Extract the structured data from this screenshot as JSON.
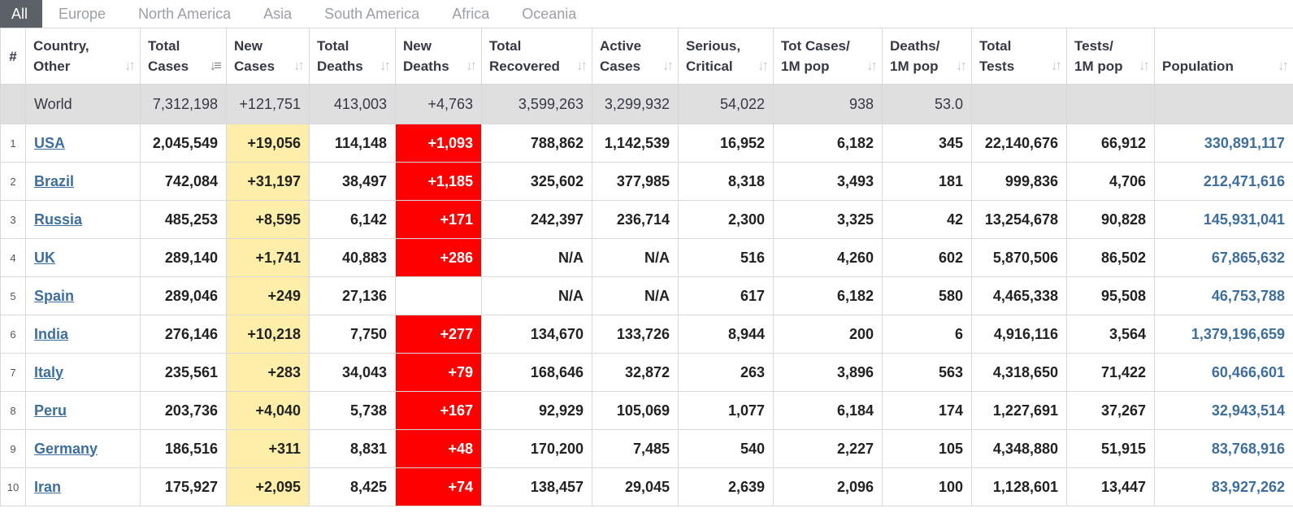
{
  "tabs": [
    "All",
    "Europe",
    "North America",
    "Asia",
    "South America",
    "Africa",
    "Oceania"
  ],
  "headers": {
    "rank": "#",
    "country": [
      "Country,",
      "Other"
    ],
    "total_cases": [
      "Total",
      "Cases"
    ],
    "new_cases": [
      "New",
      "Cases"
    ],
    "total_deaths": [
      "Total",
      "Deaths"
    ],
    "new_deaths": [
      "New",
      "Deaths"
    ],
    "total_recovered": [
      "Total",
      "Recovered"
    ],
    "active_cases": [
      "Active",
      "Cases"
    ],
    "serious": [
      "Serious,",
      "Critical"
    ],
    "tot_cases_1m": [
      "Tot Cases/",
      "1M pop"
    ],
    "deaths_1m": [
      "Deaths/",
      "1M pop"
    ],
    "total_tests": [
      "Total",
      "Tests"
    ],
    "tests_1m": [
      "Tests/",
      "1M pop"
    ],
    "population": [
      "",
      "Population"
    ]
  },
  "world": {
    "country": "World",
    "total_cases": "7,312,198",
    "new_cases": "+121,751",
    "total_deaths": "413,003",
    "new_deaths": "+4,763",
    "total_recovered": "3,599,263",
    "active_cases": "3,299,932",
    "serious": "54,022",
    "tot_cases_1m": "938",
    "deaths_1m": "53.0",
    "total_tests": "",
    "tests_1m": "",
    "population": ""
  },
  "rows": [
    {
      "rank": "1",
      "country": "USA",
      "total_cases": "2,045,549",
      "new_cases": "+19,056",
      "total_deaths": "114,148",
      "new_deaths": "+1,093",
      "total_recovered": "788,862",
      "active_cases": "1,142,539",
      "serious": "16,952",
      "tot_cases_1m": "6,182",
      "deaths_1m": "345",
      "total_tests": "22,140,676",
      "tests_1m": "66,912",
      "population": "330,891,117"
    },
    {
      "rank": "2",
      "country": "Brazil",
      "total_cases": "742,084",
      "new_cases": "+31,197",
      "total_deaths": "38,497",
      "new_deaths": "+1,185",
      "total_recovered": "325,602",
      "active_cases": "377,985",
      "serious": "8,318",
      "tot_cases_1m": "3,493",
      "deaths_1m": "181",
      "total_tests": "999,836",
      "tests_1m": "4,706",
      "population": "212,471,616"
    },
    {
      "rank": "3",
      "country": "Russia",
      "total_cases": "485,253",
      "new_cases": "+8,595",
      "total_deaths": "6,142",
      "new_deaths": "+171",
      "total_recovered": "242,397",
      "active_cases": "236,714",
      "serious": "2,300",
      "tot_cases_1m": "3,325",
      "deaths_1m": "42",
      "total_tests": "13,254,678",
      "tests_1m": "90,828",
      "population": "145,931,041"
    },
    {
      "rank": "4",
      "country": "UK",
      "total_cases": "289,140",
      "new_cases": "+1,741",
      "total_deaths": "40,883",
      "new_deaths": "+286",
      "total_recovered": "N/A",
      "active_cases": "N/A",
      "serious": "516",
      "tot_cases_1m": "4,260",
      "deaths_1m": "602",
      "total_tests": "5,870,506",
      "tests_1m": "86,502",
      "population": "67,865,632"
    },
    {
      "rank": "5",
      "country": "Spain",
      "total_cases": "289,046",
      "new_cases": "+249",
      "total_deaths": "27,136",
      "new_deaths": "",
      "total_recovered": "N/A",
      "active_cases": "N/A",
      "serious": "617",
      "tot_cases_1m": "6,182",
      "deaths_1m": "580",
      "total_tests": "4,465,338",
      "tests_1m": "95,508",
      "population": "46,753,788"
    },
    {
      "rank": "6",
      "country": "India",
      "total_cases": "276,146",
      "new_cases": "+10,218",
      "total_deaths": "7,750",
      "new_deaths": "+277",
      "total_recovered": "134,670",
      "active_cases": "133,726",
      "serious": "8,944",
      "tot_cases_1m": "200",
      "deaths_1m": "6",
      "total_tests": "4,916,116",
      "tests_1m": "3,564",
      "population": "1,379,196,659"
    },
    {
      "rank": "7",
      "country": "Italy",
      "total_cases": "235,561",
      "new_cases": "+283",
      "total_deaths": "34,043",
      "new_deaths": "+79",
      "total_recovered": "168,646",
      "active_cases": "32,872",
      "serious": "263",
      "tot_cases_1m": "3,896",
      "deaths_1m": "563",
      "total_tests": "4,318,650",
      "tests_1m": "71,422",
      "population": "60,466,601"
    },
    {
      "rank": "8",
      "country": "Peru",
      "total_cases": "203,736",
      "new_cases": "+4,040",
      "total_deaths": "5,738",
      "new_deaths": "+167",
      "total_recovered": "92,929",
      "active_cases": "105,069",
      "serious": "1,077",
      "tot_cases_1m": "6,184",
      "deaths_1m": "174",
      "total_tests": "1,227,691",
      "tests_1m": "37,267",
      "population": "32,943,514"
    },
    {
      "rank": "9",
      "country": "Germany",
      "total_cases": "186,516",
      "new_cases": "+311",
      "total_deaths": "8,831",
      "new_deaths": "+48",
      "total_recovered": "170,200",
      "active_cases": "7,485",
      "serious": "540",
      "tot_cases_1m": "2,227",
      "deaths_1m": "105",
      "total_tests": "4,348,880",
      "tests_1m": "51,915",
      "population": "83,768,916"
    },
    {
      "rank": "10",
      "country": "Iran",
      "total_cases": "175,927",
      "new_cases": "+2,095",
      "total_deaths": "8,425",
      "new_deaths": "+74",
      "total_recovered": "138,457",
      "active_cases": "29,045",
      "serious": "2,639",
      "tot_cases_1m": "2,096",
      "deaths_1m": "100",
      "total_tests": "1,128,601",
      "tests_1m": "13,447",
      "population": "83,927,262"
    }
  ],
  "colors": {
    "active_tab_bg": "#5c6168",
    "new_cases_bg": "#fdeeaa",
    "new_deaths_bg": "#ff0000",
    "world_row_bg": "#dfdfdf",
    "link_color": "#3e6f9c"
  },
  "icons": {
    "sort": "sort-arrows-icon",
    "sort_active": "sort-desc-icon"
  }
}
